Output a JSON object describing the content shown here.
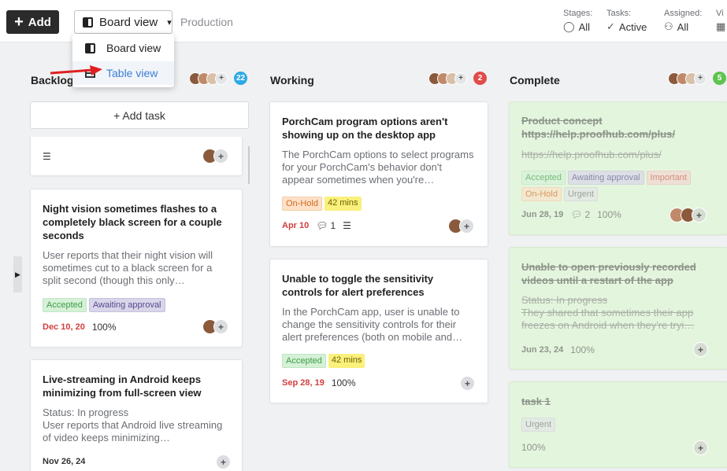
{
  "toolbar": {
    "add_label": "Add",
    "view_label": "Board view",
    "project": "Production"
  },
  "view_menu": {
    "board": "Board view",
    "table": "Table view"
  },
  "filters": {
    "stages": {
      "label": "Stages:",
      "value": "All"
    },
    "tasks": {
      "label": "Tasks:",
      "value": "Active"
    },
    "assigned": {
      "label": "Assigned:",
      "value": "All"
    },
    "view": {
      "label": "Vi"
    }
  },
  "columns": [
    {
      "title": "Backlog",
      "count": "22"
    },
    {
      "title": "Working",
      "count": "2"
    },
    {
      "title": "Complete",
      "count": "5"
    }
  ],
  "backlog": {
    "add_task": "+ Add task",
    "cards": [
      {
        "title": "Night vision sometimes flashes to a completely black screen for a couple seconds",
        "desc": "User reports that their night vision will sometimes cut to a black screen for a split second (though this only…",
        "tags": [
          "Accepted",
          "Awaiting approval"
        ],
        "date": "Dec 10, 20",
        "pct": "100%"
      },
      {
        "title": "Live-streaming in Android keeps minimizing from full-screen view",
        "desc": "Status: In progress\nUser reports that Android live streaming of video keeps minimizing…",
        "date": "Nov 26, 24"
      }
    ]
  },
  "working": {
    "cards": [
      {
        "title": "PorchCam program options aren't showing up on the desktop app",
        "desc": "The PorchCam options to select programs for your PorchCam's behavior don't appear sometimes when you're…",
        "tags": [
          "On-Hold",
          "42 mins"
        ],
        "date": "Apr 10",
        "comments": "1"
      },
      {
        "title": "Unable to toggle the sensitivity controls for alert preferences",
        "desc": "In the PorchCam app, user is unable to change the sensitivity controls for their alert preferences (both on mobile and…",
        "tags": [
          "Accepted",
          "42 mins"
        ],
        "date": "Sep 28, 19",
        "pct": "100%"
      }
    ]
  },
  "complete": {
    "cards": [
      {
        "title": "Product concept https://help.proofhub.com/plus/",
        "desc": "https://help.proofhub.com/plus/",
        "tags": [
          "Accepted",
          "Awaiting approval",
          "Important",
          "On-Hold",
          "Urgent"
        ],
        "date": "Jun 28, 19",
        "comments": "2",
        "pct": "100%"
      },
      {
        "title": "Unable to open previously recorded videos until a restart of the app",
        "desc": "Status: In progress\nThey shared that sometimes their app freezes on Android when they're tryi…",
        "date": "Jun 23, 24",
        "pct": "100%"
      },
      {
        "title": "task 1",
        "tags": [
          "Urgent"
        ],
        "pct": "100%"
      }
    ]
  },
  "colors": {
    "accent_blue": "#3a7fd8",
    "date_red": "#d63d3d",
    "complete_bg": "#e4f5de"
  }
}
